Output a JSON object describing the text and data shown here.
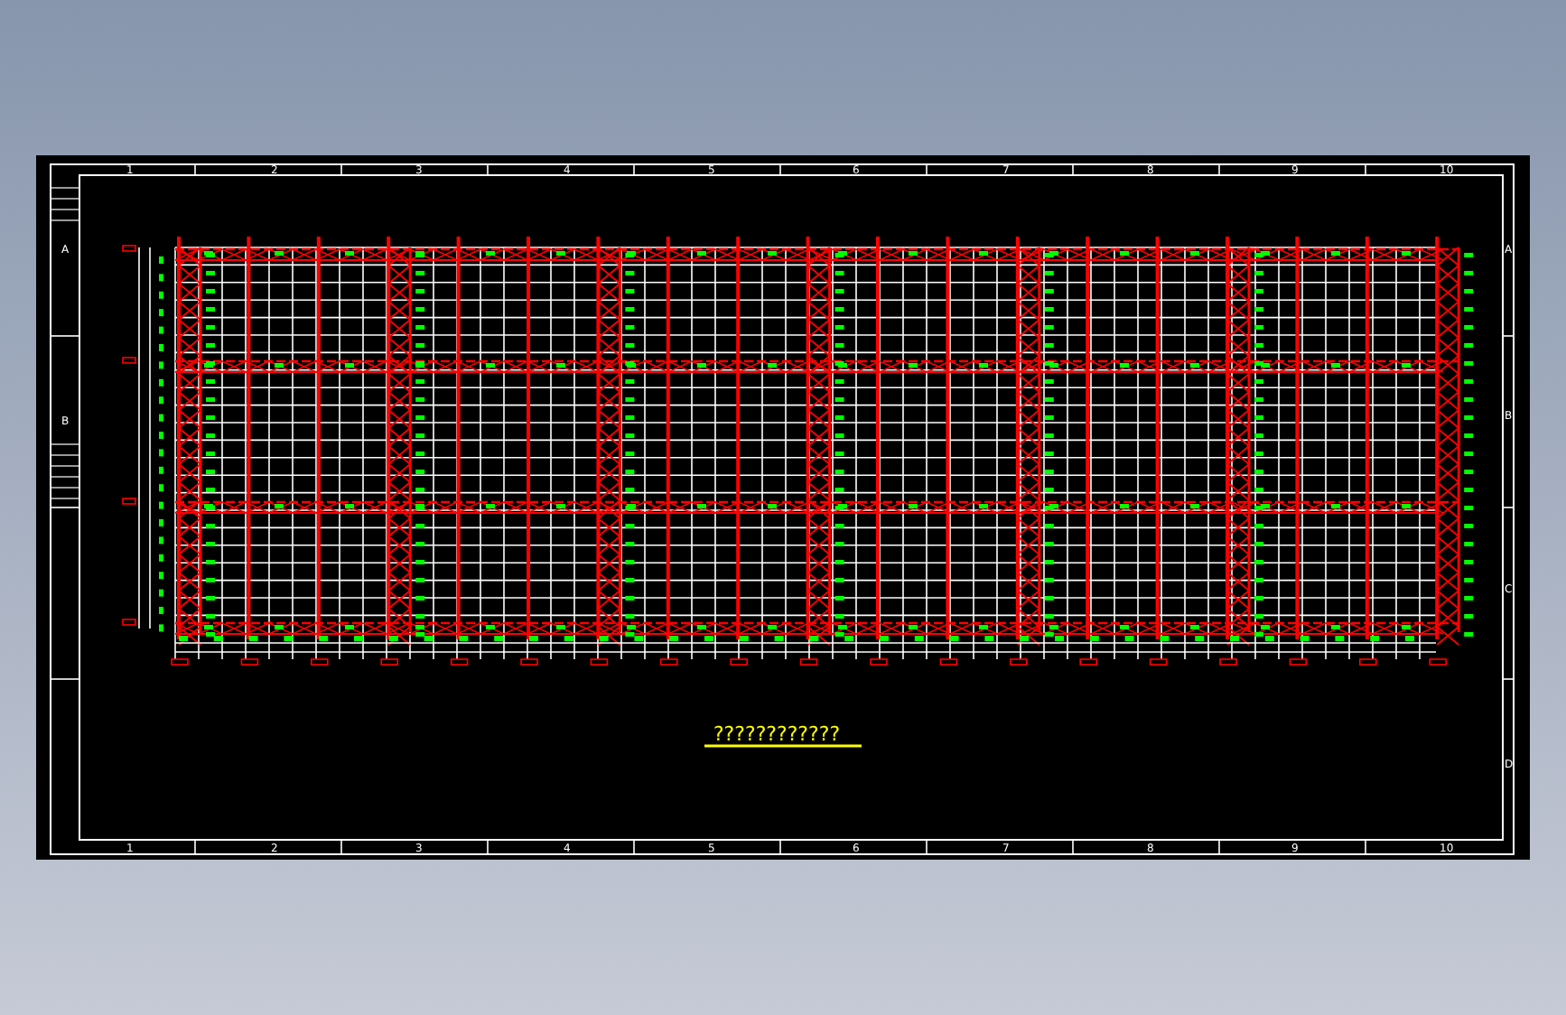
{
  "drawing": {
    "title": "????????????",
    "top_column_labels": [
      "1",
      "2",
      "3",
      "4",
      "5",
      "6",
      "7",
      "8",
      "9",
      "10"
    ],
    "bottom_column_labels": [
      "1",
      "2",
      "3",
      "4",
      "5",
      "6",
      "7",
      "8",
      "9",
      "10"
    ],
    "left_row_labels": [
      "A",
      "B"
    ],
    "right_row_labels": [
      "A",
      "B",
      "C",
      "D"
    ]
  }
}
